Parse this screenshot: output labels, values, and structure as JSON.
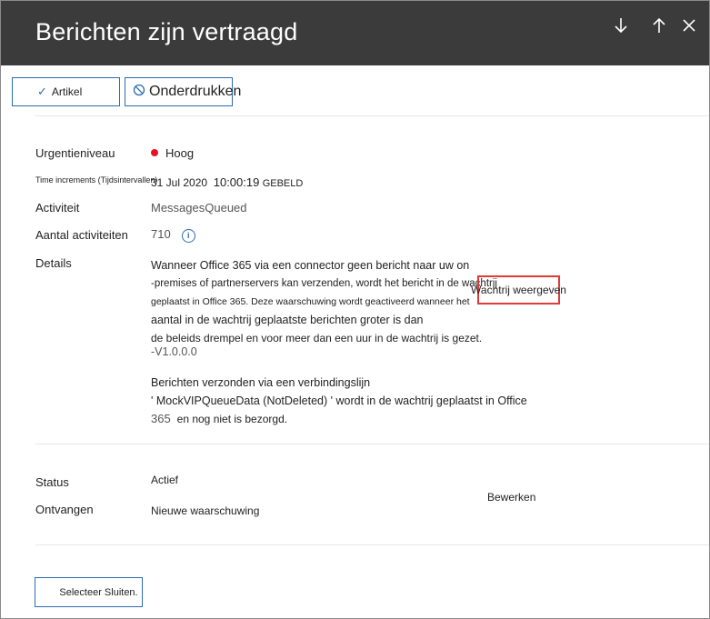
{
  "header": {
    "title": "Berichten zijn vertraagd"
  },
  "toolbar": {
    "artikel_label": "Artikel",
    "onderdrukken_label": "Onderdrukken"
  },
  "fields": {
    "urgentie_label": "Urgentieniveau",
    "urgentie_value": "Hoog",
    "urgentie_color": "#e81123",
    "time_label": "Time increments (Tijdsintervallen)",
    "time_value_date": "31 Jul 2020",
    "time_value_time": "10:00:19",
    "time_value_suffix": "GEBELD",
    "activiteit_label": "Activiteit",
    "activiteit_value": "MessagesQueued",
    "aantal_label": "Aantal activiteiten",
    "aantal_value": "710",
    "details_label": "Details"
  },
  "details": {
    "line1": "Wanneer Office 365 via een connector geen bericht naar uw on",
    "line2": "-premises of partnerservers kan verzenden, wordt het bericht in de wachtrij",
    "line3": "geplaatst in Office 365. Deze waarschuwing wordt geactiveerd wanneer het",
    "line4": "aantal in de wachtrij geplaatste berichten groter is dan",
    "line5": "de beleids drempel en voor meer dan een uur in de wachtrij is gezet.",
    "line6": "-V1.0.0.0",
    "line7": "Berichten verzonden via een verbindingslijn",
    "line8": "' MockVIPQueueData (NotDeleted) ' wordt in de wachtrij geplaatst in Office",
    "line9a": "365",
    "line9b": "en nog niet is bezorgd.",
    "queue_link": "Wachtrij weergeven"
  },
  "status": {
    "status_label": "Status",
    "status_value": "Actief",
    "ontvangen_label": "Ontvangen",
    "ontvangen_value": "Nieuwe waarschuwing",
    "edit_label": "Bewerken"
  },
  "footer": {
    "select_close_label": "Selecteer Sluiten."
  }
}
